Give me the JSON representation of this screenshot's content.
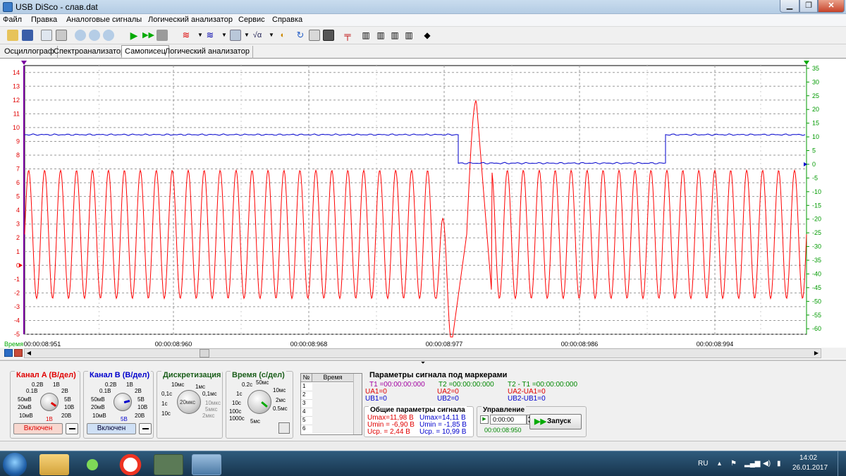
{
  "window": {
    "title": "USB DiSco - слав.dat"
  },
  "menu": [
    "Файл",
    "Правка",
    "Аналоговые сигналы",
    "Логический анализатор",
    "Сервис",
    "Справка"
  ],
  "tabs": [
    {
      "label": "Осциллограф"
    },
    {
      "label": "Спектроанализатор"
    },
    {
      "label": "Самописец",
      "active": true
    },
    {
      "label": "Логический анализатор"
    }
  ],
  "plot": {
    "time_label": "Время",
    "x_ticks": [
      "00:00:08:951",
      "00:00:08:960",
      "00:00:08:968",
      "00:00:08:977",
      "00:00:08:986",
      "00:00:08:994"
    ],
    "left_ticks": [
      "14",
      "13",
      "12",
      "11",
      "10",
      "9",
      "8",
      "7",
      "6",
      "5",
      "4",
      "3",
      "2",
      "1",
      "0",
      "-1",
      "-2",
      "-3",
      "-4",
      "-5"
    ],
    "right_ticks": [
      "35",
      "30",
      "25",
      "20",
      "15",
      "10",
      "5",
      "0",
      "-5",
      "-10",
      "-15",
      "-20",
      "-25",
      "-30",
      "-35",
      "-40",
      "-45",
      "-50",
      "-55",
      "-60"
    ]
  },
  "chart_data": {
    "type": "line",
    "x_range": [
      "00:00:08:951",
      "00:00:08:999"
    ],
    "left_axis": {
      "range": [
        -5,
        14.5
      ],
      "color": "#e00000"
    },
    "right_axis": {
      "range": [
        -62,
        36
      ],
      "color": "#009a00"
    },
    "grid": true,
    "series": [
      {
        "color": "#ff0000",
        "axis": "left",
        "shape": "sine",
        "amplitude_min": -2.4,
        "amplitude_max": 6.9,
        "cycles": 49,
        "disturbance": {
          "x": "00:00:08:977",
          "min": -5.2,
          "max": 11.98
        }
      },
      {
        "color": "#0000cc",
        "axis": "right",
        "segments": [
          {
            "from": "00:00:08:951",
            "to": "00:00:08:976",
            "value": 10.8
          },
          {
            "from": "00:00:08:976",
            "to": "00:00:08:989",
            "value": 0.4
          },
          {
            "from": "00:00:08:989",
            "to": "00:00:08:999",
            "value": 10.8
          }
        ]
      }
    ]
  },
  "channelA": {
    "title": "Канал A (В/дел)",
    "color": "#e00000",
    "labels": [
      "0.2В",
      "1В",
      "0.1В",
      "2В",
      "50мВ",
      "5В",
      "20мВ",
      "10В",
      "10мВ",
      "20В"
    ],
    "value": "1В",
    "button": "Включен"
  },
  "channelB": {
    "title": "Канал B (В/дел)",
    "color": "#0000cc",
    "labels": [
      "0.2В",
      "1В",
      "0.1В",
      "2В",
      "50мВ",
      "5В",
      "20мВ",
      "10В",
      "10мВ",
      "20В"
    ],
    "value": "5В",
    "button": "Включен"
  },
  "sampling": {
    "title": "Дискретизация",
    "labels": [
      "10мс",
      "1мс",
      "0,1с",
      "0,1мс",
      "1с",
      "10мкс",
      "10с",
      "5мкс",
      "2мкс"
    ],
    "value": "20мкс"
  },
  "timediv": {
    "title": "Время (с/дел)",
    "labels": [
      "0.2с",
      "50мс",
      "1с",
      "10мс",
      "10с",
      "2мс",
      "100с",
      "0.5мс",
      "1000с",
      "5мс"
    ]
  },
  "table": {
    "col_no": "№",
    "col_time": "Время",
    "rows": [
      "1",
      "2",
      "3",
      "4",
      "5",
      "6"
    ]
  },
  "markers": {
    "title": "Параметры сигнала под маркерами",
    "t1": "T1 =00:00:00:000",
    "t2": "T2 =00:00:00:000",
    "dt": "T2 - T1 =00:00:00:000",
    "ua1": "UA1=0",
    "ub1": "UB1=0",
    "ua2": "UA2=0",
    "ub2": "UB2=0",
    "dua": "UA2-UA1=0",
    "dub": "UB2-UB1=0"
  },
  "general": {
    "title": "Общие параметры сигнала",
    "a_umax": "Umax=11,98 В",
    "a_umin": "Umin = -6,90 В",
    "a_usr": "Uср. =  2,44 В",
    "b_umax": "Umax=14,11 В",
    "b_umin": "Umin = -1,85 В",
    "b_usr": "Uср. = 10,99 В"
  },
  "control": {
    "title": "Управление",
    "time_value": "0:00:00",
    "current_time": "00:00:08:950",
    "start_label": "Запуск"
  },
  "taskbar": {
    "lang": "RU",
    "time": "14:02",
    "date": "26.01.2017"
  }
}
